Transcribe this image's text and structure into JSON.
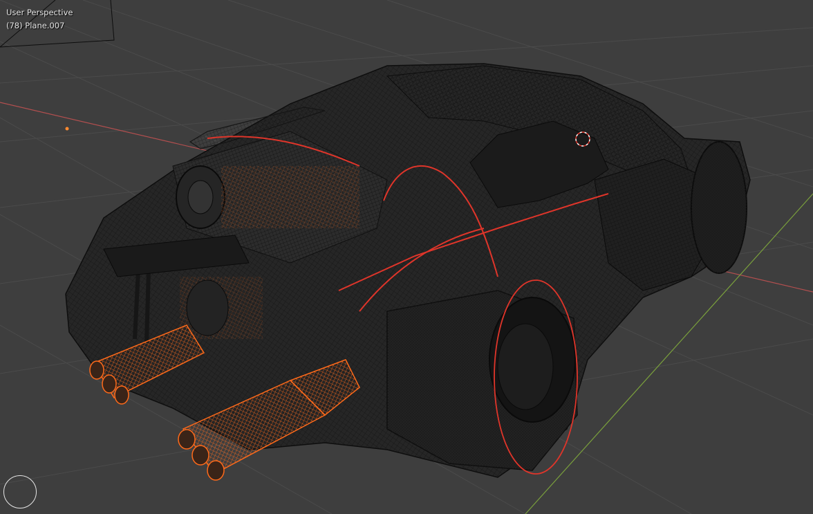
{
  "viewport": {
    "view_name": "User Perspective",
    "active_object": "(78) Plane.007",
    "shading": "wireframe",
    "nav_gizmo_icon": "view-navigation-circle-icon",
    "cursor_icon": "3d-cursor-icon"
  },
  "colors": {
    "background": "#3e3e3e",
    "grid": "#4a4a4a",
    "x_axis": "#b34f4f",
    "y_axis": "#7aa03c",
    "wire": "#141414",
    "selected_wire": "#ff6a1a",
    "highlight_wire": "#e0352a",
    "hud_text": "#e6e6e6"
  }
}
